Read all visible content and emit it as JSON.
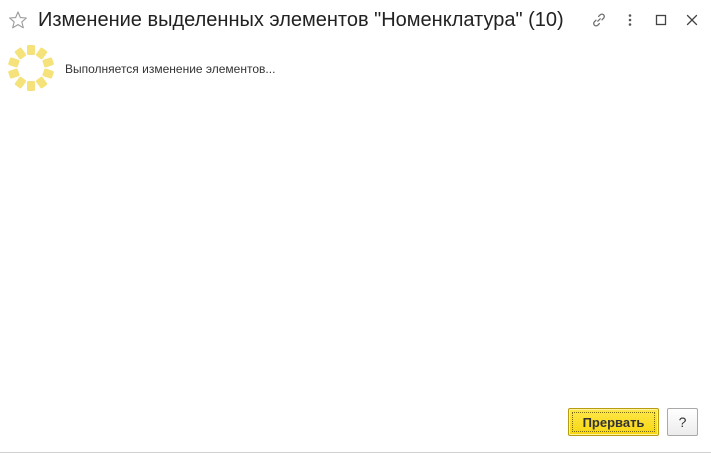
{
  "window": {
    "title": "Изменение выделенных элементов \"Номенклатура\" (10)"
  },
  "title_controls": [
    {
      "icon": "link-icon"
    },
    {
      "icon": "more-icon"
    },
    {
      "icon": "maximize-icon"
    },
    {
      "icon": "close-icon"
    }
  ],
  "content": {
    "status_text": "Выполняется изменение элементов..."
  },
  "buttons": {
    "abort_label": "Прервать",
    "help_label": "?"
  },
  "colors": {
    "accent": "#f7d60f",
    "spinner": "#f5e27a"
  }
}
